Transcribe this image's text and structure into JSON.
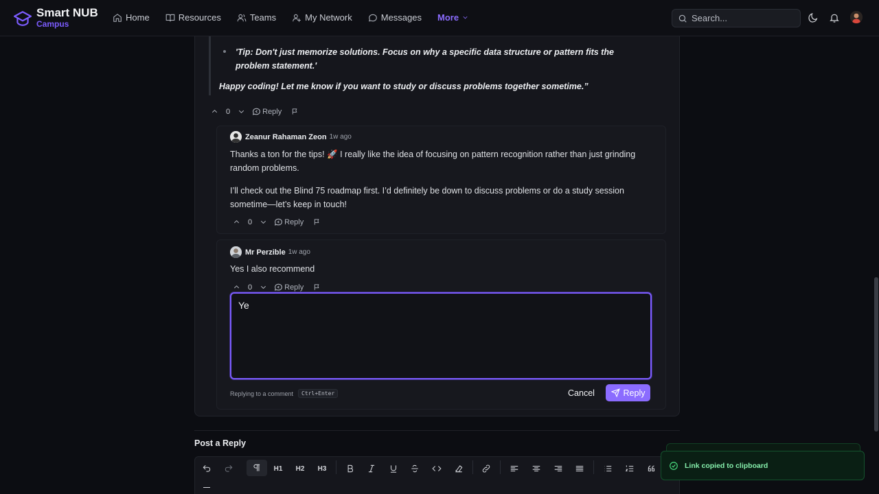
{
  "brand": {
    "name": "Smart NUB",
    "sub": "Campus"
  },
  "nav": {
    "items": [
      {
        "label": "Home",
        "icon": "home-icon"
      },
      {
        "label": "Resources",
        "icon": "book-icon"
      },
      {
        "label": "Teams",
        "icon": "users-icon"
      },
      {
        "label": "My Network",
        "icon": "user-network-icon"
      },
      {
        "label": "Messages",
        "icon": "message-icon"
      }
    ],
    "more_label": "More",
    "search_placeholder": "Search..."
  },
  "post": {
    "tip": "'Tip: Don't just memorize solutions. Focus on why a specific data structure or pattern fits the problem statement.'",
    "closing": "Happy coding! Let me know if you want to study or discuss problems together sometime.”",
    "votes": "0",
    "reply_label": "Reply"
  },
  "comments": [
    {
      "author": "Zeanur Rahaman Zeon",
      "time": "1w ago",
      "paragraph1": "Thanks a ton for the tips! 🚀 I really like the idea of focusing on pattern recognition rather than just grinding random problems.",
      "paragraph2": "I’ll check out the Blind 75 roadmap first. I’d definitely be down to discuss problems or do a study session sometime—let’s keep in touch!",
      "votes": "0",
      "reply_label": "Reply"
    },
    {
      "author": "Mr Perzible",
      "time": "1w ago",
      "paragraph1": "Yes I also recommend",
      "votes": "0",
      "reply_label": "Reply"
    }
  ],
  "reply_form": {
    "value": "Ye",
    "hint": "Replying to a comment",
    "shortcut": "Ctrl+Enter",
    "cancel_label": "Cancel",
    "submit_label": "Reply"
  },
  "post_reply": {
    "title": "Post a Reply",
    "toolbar": {
      "h1": "H1",
      "h2": "H2",
      "h3": "H3"
    }
  },
  "toast": {
    "message": "Link copied to clipboard"
  },
  "colors": {
    "accent": "#8b6cff",
    "background": "#0c0d12",
    "success": "#4ade80"
  }
}
